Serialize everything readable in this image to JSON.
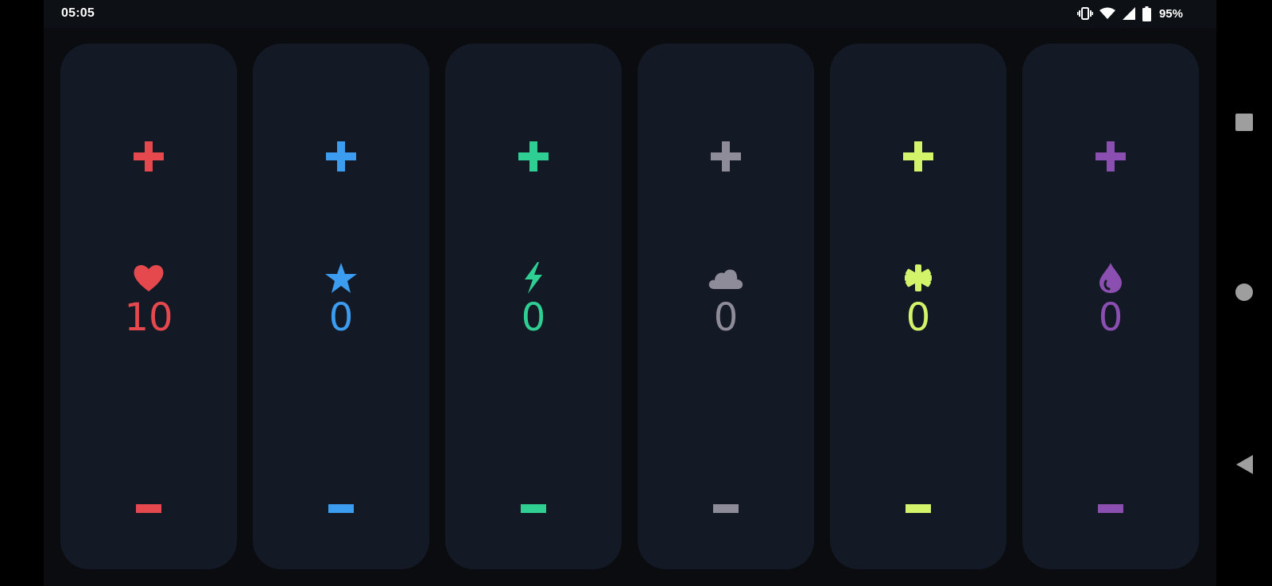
{
  "status_bar": {
    "time": "05:05",
    "battery": "95%",
    "icons": [
      "vibrate-icon",
      "wifi-icon",
      "cell-signal-icon",
      "battery-icon"
    ]
  },
  "counters": [
    {
      "id": "red",
      "icon": "heart-icon",
      "color": "#e5484d",
      "value": "10"
    },
    {
      "id": "blue",
      "icon": "star-icon",
      "color": "#3b9cf0",
      "value": "0"
    },
    {
      "id": "green",
      "icon": "bolt-icon",
      "color": "#2fcf94",
      "value": "0"
    },
    {
      "id": "gray",
      "icon": "cloud-icon",
      "color": "#8e8c99",
      "value": "0"
    },
    {
      "id": "lime",
      "icon": "asterisk-icon",
      "color": "#d2f36a",
      "value": "0"
    },
    {
      "id": "purple",
      "icon": "drop-icon",
      "color": "#8a4fb0",
      "value": "0"
    }
  ],
  "nav_bar": {
    "buttons": [
      "recents-button",
      "home-button",
      "back-button"
    ]
  }
}
